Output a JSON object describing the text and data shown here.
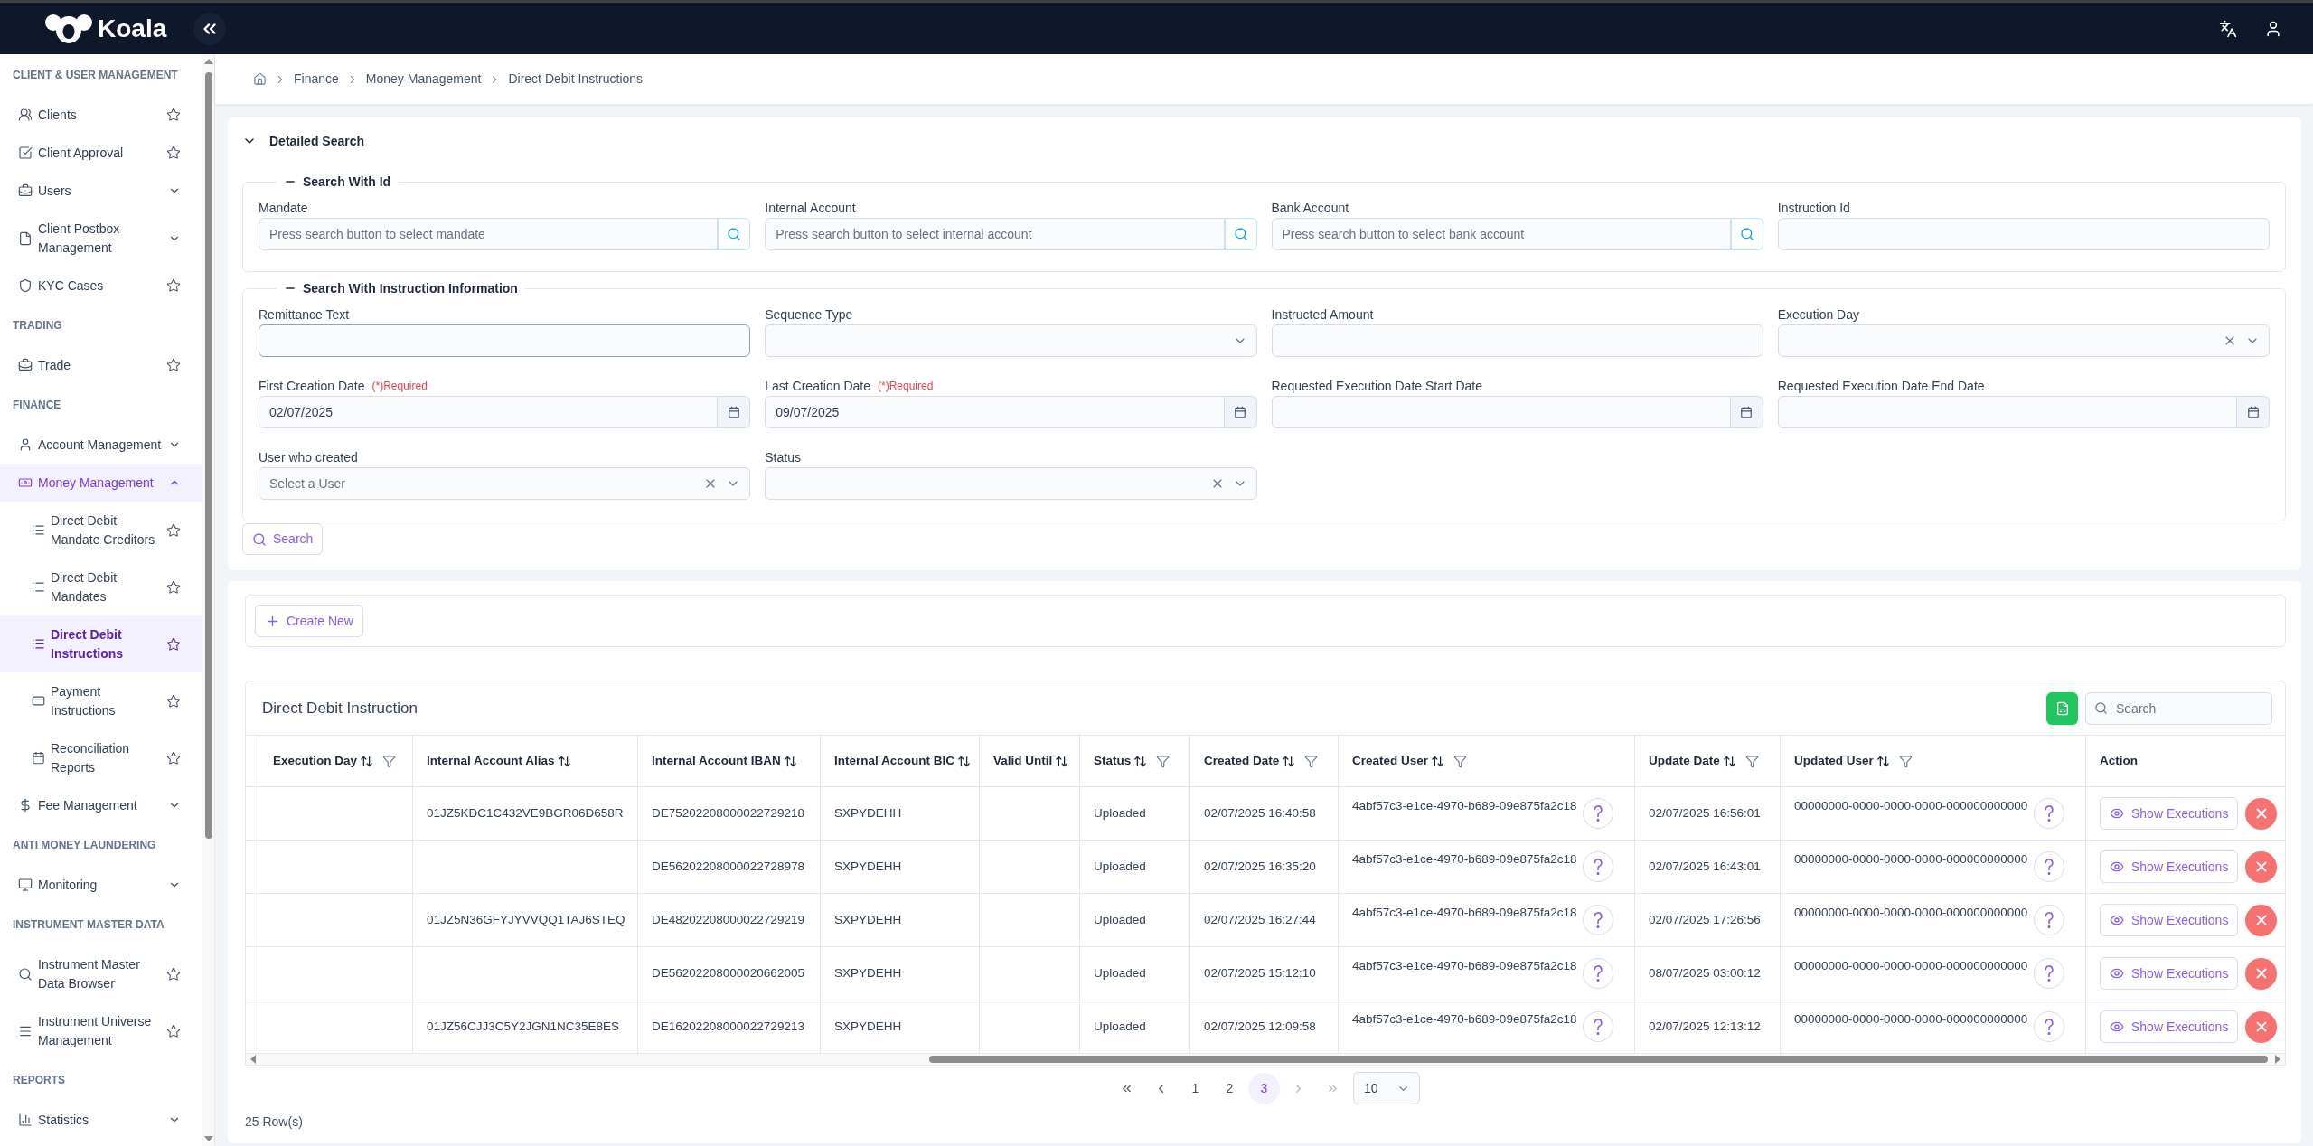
{
  "top_bar": {
    "brand": "Koala"
  },
  "sidebar": {
    "sections": [
      {
        "title": "CLIENT & USER MANAGEMENT",
        "items": [
          {
            "label": "Clients",
            "kind": "page",
            "favorite": false,
            "selected": false
          },
          {
            "label": "Client Approval",
            "kind": "page",
            "favorite": false,
            "selected": false
          },
          {
            "label": "Users",
            "kind": "group",
            "expanded": false,
            "selected": false
          },
          {
            "label": "Client Postbox Management",
            "kind": "group",
            "expanded": false,
            "selected": false
          },
          {
            "label": "KYC Cases",
            "kind": "page",
            "favorite": false,
            "selected": false
          }
        ]
      },
      {
        "title": "TRADING",
        "items": [
          {
            "label": "Trade",
            "kind": "page",
            "favorite": false,
            "selected": false
          }
        ]
      },
      {
        "title": "FINANCE",
        "items": [
          {
            "label": "Account Management",
            "kind": "group",
            "expanded": false,
            "selected": false
          },
          {
            "label": "Money Management",
            "kind": "group",
            "expanded": true,
            "selected": true,
            "children": [
              {
                "label": "Direct Debit Mandate Creditors",
                "favorite": false,
                "selected": false
              },
              {
                "label": "Direct Debit Mandates",
                "favorite": false,
                "selected": false
              },
              {
                "label": "Direct Debit Instructions",
                "favorite": false,
                "selected": true
              },
              {
                "label": "Payment Instructions",
                "favorite": false,
                "selected": false
              },
              {
                "label": "Reconciliation Reports",
                "favorite": false,
                "selected": false
              }
            ]
          },
          {
            "label": "Fee Management",
            "kind": "group",
            "expanded": false,
            "selected": false
          }
        ]
      },
      {
        "title": "ANTI MONEY LAUNDERING",
        "items": [
          {
            "label": "Monitoring",
            "kind": "group",
            "expanded": false,
            "selected": false
          }
        ]
      },
      {
        "title": "INSTRUMENT MASTER DATA",
        "items": [
          {
            "label": "Instrument Master Data Browser",
            "kind": "page",
            "favorite": false,
            "selected": false
          },
          {
            "label": "Instrument Universe Management",
            "kind": "page",
            "favorite": false,
            "selected": false
          }
        ]
      },
      {
        "title": "REPORTS",
        "items": [
          {
            "label": "Statistics",
            "kind": "group",
            "expanded": false,
            "selected": false
          }
        ]
      }
    ]
  },
  "breadcrumb": [
    "Finance",
    "Money Management",
    "Direct Debit Instructions"
  ],
  "detailed_search": {
    "title": "Detailed Search",
    "expanded": true,
    "groups": [
      {
        "legend": "Search With Id",
        "expanded": true,
        "fields": [
          {
            "label": "Mandate",
            "kind": "lookup",
            "placeholder": "Press search button to select mandate",
            "focused": false
          },
          {
            "label": "Internal Account",
            "kind": "lookup",
            "placeholder": "Press search button to select internal account",
            "focused": false
          },
          {
            "label": "Bank Account",
            "kind": "lookup",
            "placeholder": "Press search button to select bank account",
            "focused": false
          },
          {
            "label": "Instruction Id",
            "kind": "text",
            "focused": false
          }
        ]
      },
      {
        "legend": "Search With Instruction Information",
        "expanded": true,
        "fields": [
          {
            "label": "Remittance Text",
            "kind": "text",
            "focused": true
          },
          {
            "label": "Sequence Type",
            "kind": "select",
            "focused": false
          },
          {
            "label": "Instructed Amount",
            "kind": "text",
            "focused": false
          },
          {
            "label": "Execution Day",
            "kind": "combo",
            "focused": false
          },
          {
            "label": "First Creation Date",
            "kind": "date",
            "required_note": "(*)Required",
            "value": "02/07/2025",
            "focused": false
          },
          {
            "label": "Last Creation Date",
            "kind": "date",
            "required_note": "(*)Required",
            "value": "09/07/2025",
            "focused": false
          },
          {
            "label": "Requested Execution Date Start Date",
            "kind": "date",
            "focused": false
          },
          {
            "label": "Requested Execution Date End Date",
            "kind": "date",
            "focused": false
          },
          {
            "label": "User who created",
            "kind": "combo",
            "placeholder": "Select a User",
            "focused": false
          },
          {
            "label": "Status",
            "kind": "combo",
            "focused": false
          }
        ]
      }
    ],
    "search_button": "Search"
  },
  "create_button": "Create New",
  "table": {
    "title": "Direct Debit Instruction",
    "search": {
      "placeholder": "Search"
    },
    "columns": [
      {
        "label": "Execution Day",
        "kind": "text",
        "sortable": true,
        "filterable": true
      },
      {
        "label": "Internal Account Alias",
        "kind": "text",
        "sortable": true,
        "filterable": false
      },
      {
        "label": "Internal Account IBAN",
        "kind": "text",
        "sortable": true,
        "filterable": false
      },
      {
        "label": "Internal Account BIC",
        "kind": "text",
        "sortable": true,
        "filterable": false
      },
      {
        "label": "Valid Until",
        "kind": "text",
        "sortable": true,
        "filterable": false
      },
      {
        "label": "Status",
        "kind": "text",
        "sortable": true,
        "filterable": true
      },
      {
        "label": "Created Date",
        "kind": "text",
        "sortable": true,
        "filterable": true
      },
      {
        "label": "Created User",
        "kind": "user",
        "sortable": true,
        "filterable": true
      },
      {
        "label": "Update Date",
        "kind": "text",
        "sortable": true,
        "filterable": true
      },
      {
        "label": "Updated User",
        "kind": "user",
        "sortable": true,
        "filterable": true
      },
      {
        "label": "Action",
        "kind": "actions",
        "sortable": false,
        "filterable": false
      }
    ],
    "rows": [
      {
        "internal_account_alias": "01JZ5KDC1C432VE9BGR06D658R",
        "internal_account_iban": "DE75202208000022729218",
        "internal_account_bic": "SXPYDEHH",
        "status": "Uploaded",
        "created_date": "02/07/2025 16:40:58",
        "created_user": "4abf57c3-e1ce-4970-b689-09e875fa2c18",
        "update_date": "02/07/2025 16:56:01",
        "updated_user": "00000000-0000-0000-0000-000000000000",
        "action": "Show Executions"
      },
      {
        "internal_account_iban": "DE56202208000022728978",
        "internal_account_bic": "SXPYDEHH",
        "status": "Uploaded",
        "created_date": "02/07/2025 16:35:20",
        "created_user": "4abf57c3-e1ce-4970-b689-09e875fa2c18",
        "update_date": "02/07/2025 16:43:01",
        "updated_user": "00000000-0000-0000-0000-000000000000",
        "action": "Show Executions"
      },
      {
        "internal_account_alias": "01JZ5N36GFYJYVVQQ1TAJ6STEQ",
        "internal_account_iban": "DE48202208000022729219",
        "internal_account_bic": "SXPYDEHH",
        "status": "Uploaded",
        "created_date": "02/07/2025 16:27:44",
        "created_user": "4abf57c3-e1ce-4970-b689-09e875fa2c18",
        "update_date": "02/07/2025 17:26:56",
        "updated_user": "00000000-0000-0000-0000-000000000000",
        "action": "Show Executions"
      },
      {
        "internal_account_iban": "DE56202208000020662005",
        "internal_account_bic": "SXPYDEHH",
        "status": "Uploaded",
        "created_date": "02/07/2025 15:12:10",
        "created_user": "4abf57c3-e1ce-4970-b689-09e875fa2c18",
        "update_date": "08/07/2025 03:00:12",
        "updated_user": "00000000-0000-0000-0000-000000000000",
        "action": "Show Executions"
      },
      {
        "internal_account_alias": "01JZ56CJJ3C5Y2JGN1NC35E8ES",
        "internal_account_iban": "DE16202208000022729213",
        "internal_account_bic": "SXPYDEHH",
        "status": "Uploaded",
        "created_date": "02/07/2025 12:09:58",
        "created_user": "4abf57c3-e1ce-4970-b689-09e875fa2c18",
        "update_date": "02/07/2025 12:13:12",
        "updated_user": "00000000-0000-0000-0000-000000000000",
        "action": "Show Executions"
      }
    ],
    "pagination": {
      "nav": {
        "first": {
          "disabled": false
        },
        "previous": {
          "disabled": false
        },
        "next": {
          "disabled": true
        },
        "last": {
          "disabled": true
        }
      },
      "pages": [
        {
          "label": "1",
          "selected": false
        },
        {
          "label": "2",
          "selected": false
        },
        {
          "label": "3",
          "selected": true
        }
      ],
      "page_size": "10"
    },
    "row_count": "25 Row(s)"
  }
}
